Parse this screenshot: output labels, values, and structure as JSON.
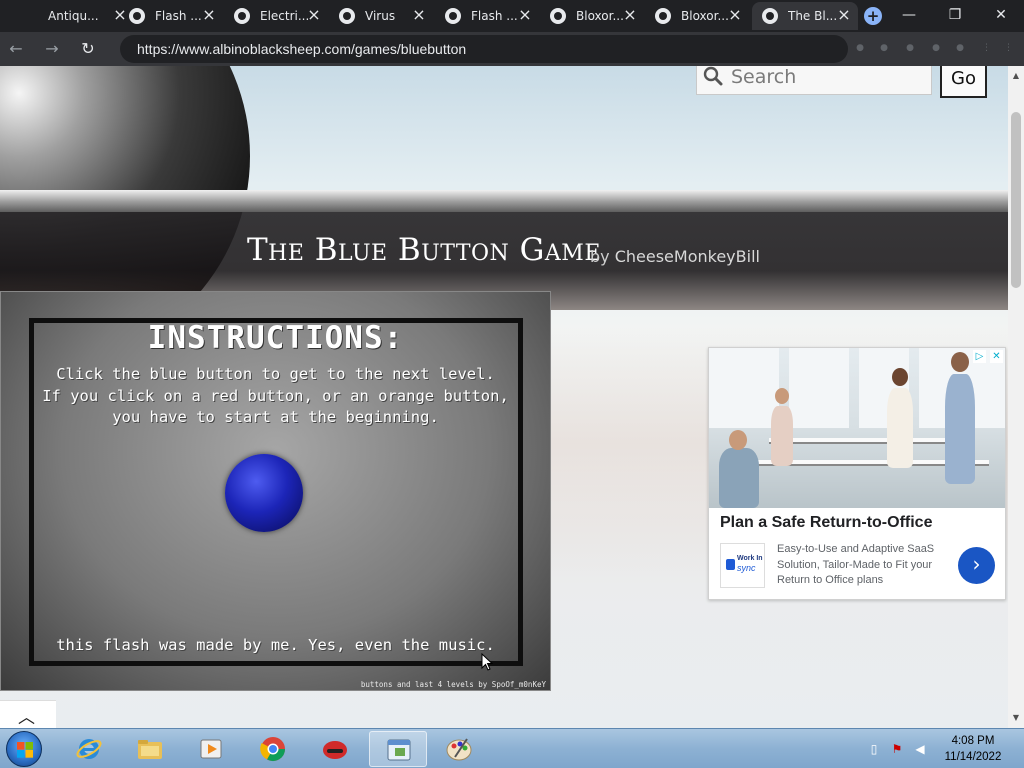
{
  "browser": {
    "tabs": [
      {
        "title": "Antiqu..."
      },
      {
        "title": "Flash ..."
      },
      {
        "title": "Electri..."
      },
      {
        "title": "Virus"
      },
      {
        "title": "Flash ..."
      },
      {
        "title": "Bloxor..."
      },
      {
        "title": "Bloxor..."
      },
      {
        "title": "The Bl...",
        "active": true
      }
    ],
    "url": "https://www.albinoblacksheep.com/games/bluebutton"
  },
  "header": {
    "search_placeholder": "Search",
    "go_label": "Go",
    "title": "The Blue Button Game",
    "by_label": "by",
    "author": "CheeseMonkeyBill"
  },
  "game": {
    "instructions_title": "INSTRUCTIONS:",
    "instructions_text": "Click the blue button to get to the next level.\nIf you click on a red button, or an orange button,\nyou have to start at the beginning.",
    "footer_text": "this flash was made by me. Yes, even the music.",
    "credit": "buttons and last 4 levels by SpoOf_m0nKeY"
  },
  "ad": {
    "headline": "Plan a Safe Return-to-Office",
    "body": "Easy-to-Use and Adaptive SaaS Solution, Tailor-Made to Fit your Return to Office plans",
    "logo_line1": "Work In",
    "logo_line2": "sync"
  },
  "taskbar": {
    "time": "4:08 PM",
    "date": "11/14/2022"
  },
  "colors": {
    "blue_button": "#1c25b8",
    "ad_cta": "#1a56c4",
    "browser_dark": "#202124"
  }
}
